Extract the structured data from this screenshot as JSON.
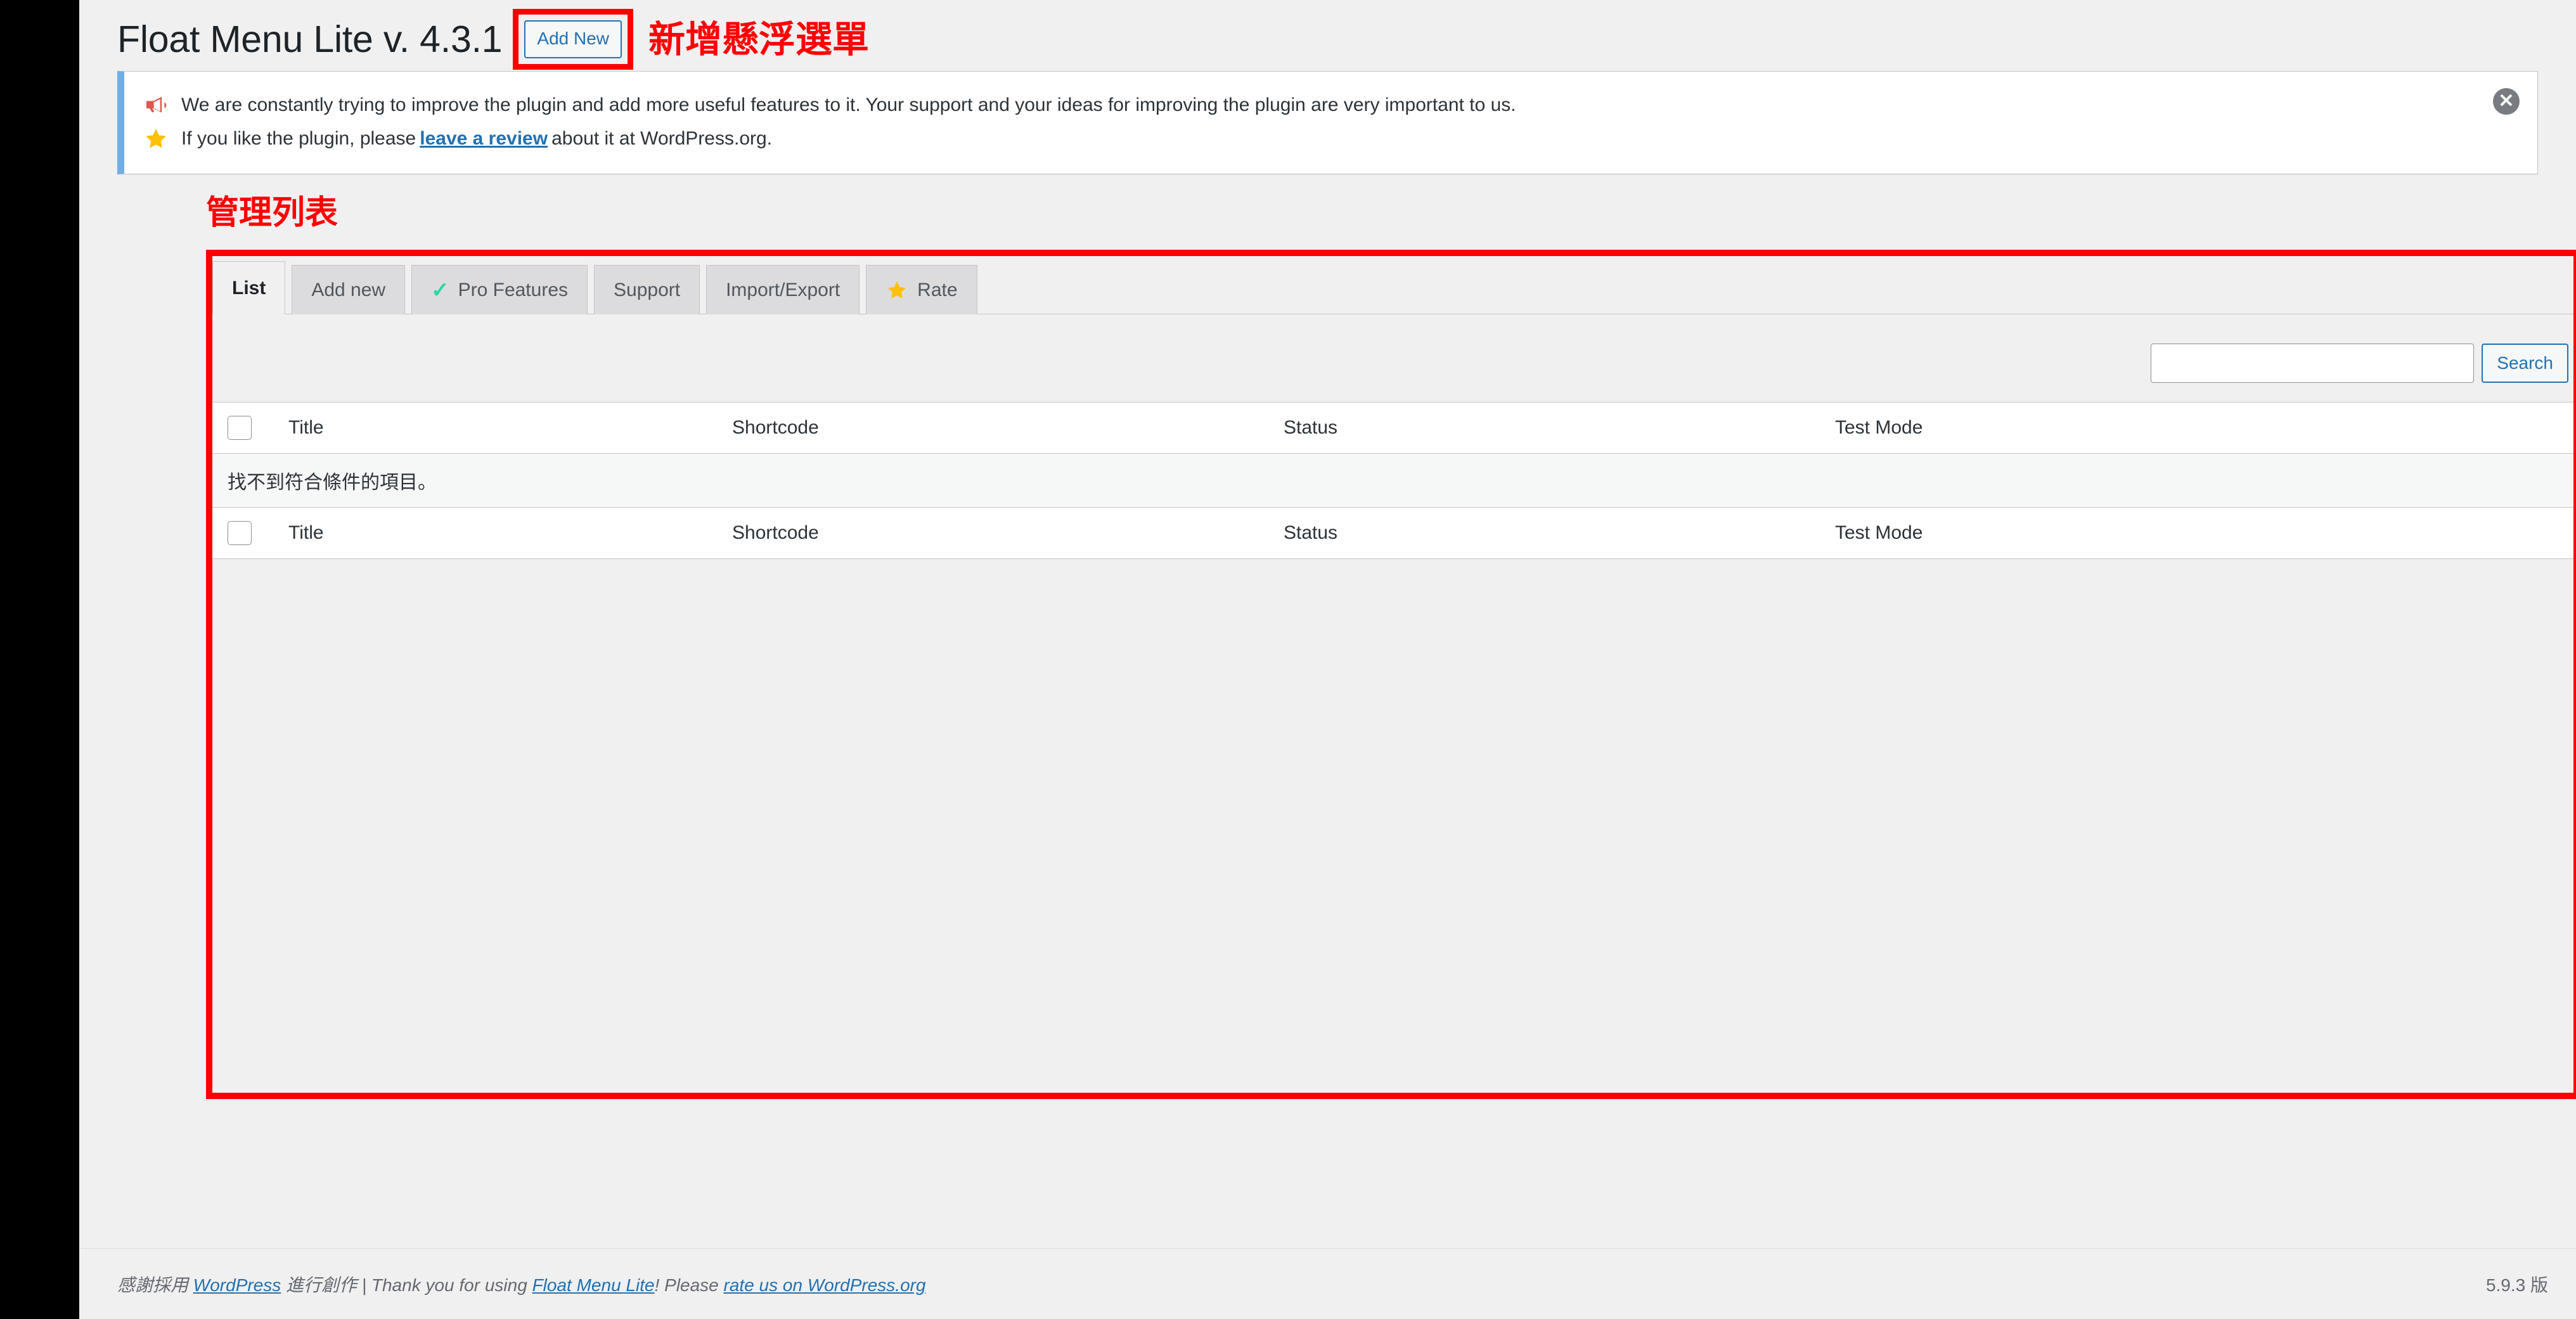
{
  "header": {
    "page_title": "Float Menu Lite v. 4.3.1",
    "add_new_label": "Add New",
    "annotation_add_new": "新增懸浮選單"
  },
  "notice": {
    "line1_icon": "megaphone-icon",
    "line1_text": "We are constantly trying to improve the plugin and add more useful features to it. Your support and your ideas for improving the plugin are very important to us.",
    "line2_icon": "star-icon",
    "line2_prefix": "If you like the plugin, please",
    "line2_link": "leave a review",
    "line2_suffix": "about it at WordPress.org.",
    "dismiss_icon": "close-icon",
    "dismiss_glyph": "✕",
    "accent_border": "#72aee6"
  },
  "annotations": {
    "list_label": "管理列表",
    "box_color": "#ff0000"
  },
  "tabs": [
    {
      "label": "List",
      "icon": null,
      "active": true
    },
    {
      "label": "Add new",
      "icon": null,
      "active": false
    },
    {
      "label": "Pro Features",
      "icon": "check-icon",
      "active": false
    },
    {
      "label": "Support",
      "icon": null,
      "active": false
    },
    {
      "label": "Import/Export",
      "icon": null,
      "active": false
    },
    {
      "label": "Rate",
      "icon": "star-icon",
      "active": false
    }
  ],
  "search": {
    "value": "",
    "placeholder": "",
    "button_label": "Search"
  },
  "table": {
    "columns": [
      "Title",
      "Shortcode",
      "Status",
      "Test Mode"
    ],
    "select_all_checked": false,
    "rows": [],
    "empty_message": "找不到符合條件的項目。"
  },
  "footer": {
    "thanks_prefix": "感謝採用",
    "wordpress_link": "WordPress",
    "thanks_mid": "進行創作 | Thank you for using",
    "plugin_link": "Float Menu Lite",
    "thanks_suffix": "! Please",
    "rate_link": "rate us on WordPress.org",
    "version": "5.9.3 版"
  },
  "colors": {
    "page_bg": "#f0f0f1",
    "accent_blue": "#2271b1",
    "check_teal": "#2bd4a7",
    "star_gold": "#ffc008",
    "megaphone_red": "#e0564c"
  }
}
